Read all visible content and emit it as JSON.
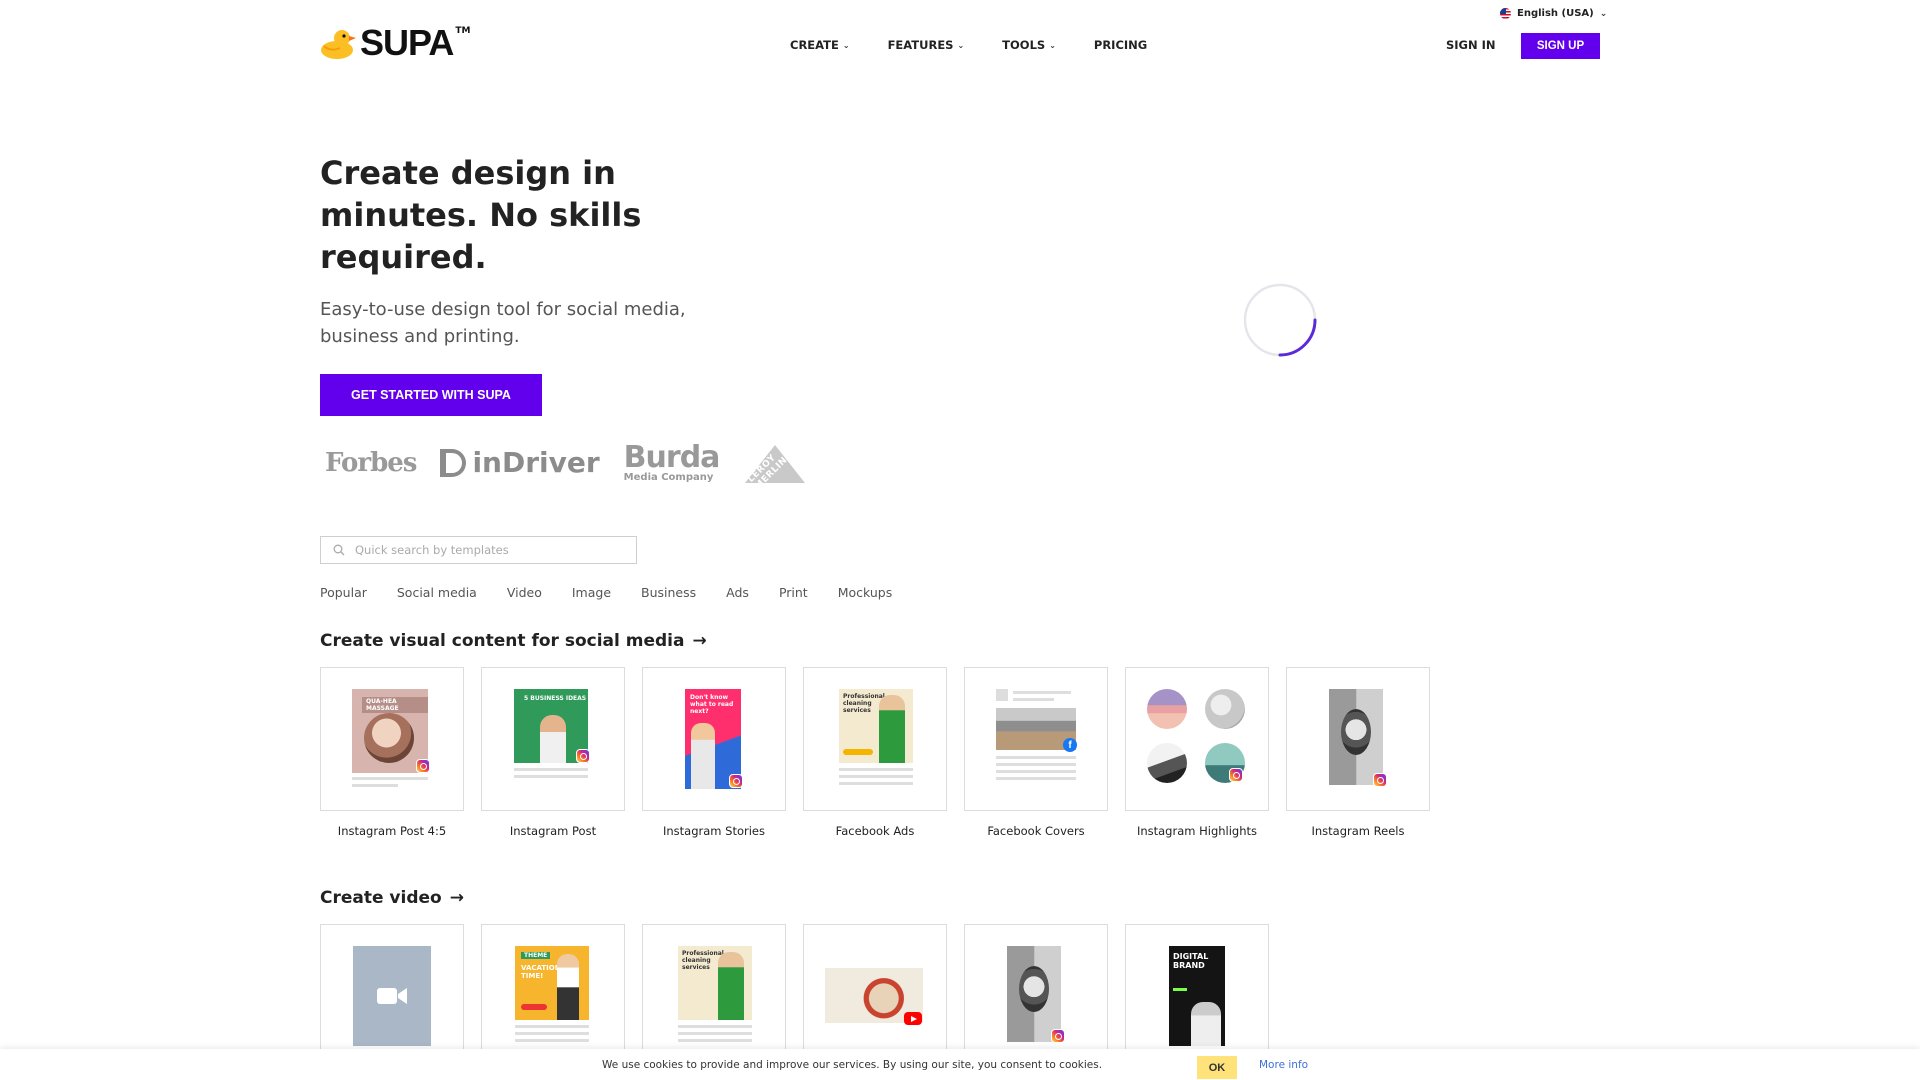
{
  "header": {
    "language": "English (USA)",
    "logo_text": "SUPA",
    "logo_tm": "TM",
    "nav": [
      "CREATE",
      "FEATURES",
      "TOOLS",
      "PRICING"
    ],
    "sign_in": "SIGN IN",
    "sign_up": "SIGN UP"
  },
  "hero": {
    "title": "Create design in minutes. No skills required.",
    "subtitle": "Easy-to-use design tool for social media, business and printing.",
    "cta": "GET STARTED WITH SUPA",
    "brands": {
      "forbes": "Forbes",
      "indriver": "inDriver",
      "burda": "Burda",
      "burda_sub": "Media Company",
      "leroy": "LEROY MERLIN"
    }
  },
  "search": {
    "placeholder": "Quick search by templates"
  },
  "tabs": [
    "Popular",
    "Social media",
    "Video",
    "Image",
    "Business",
    "Ads",
    "Print",
    "Mockups"
  ],
  "social_section": {
    "title": "Create visual content for social media",
    "arrow": "→",
    "cards": [
      "Instagram Post 4:5",
      "Instagram Post",
      "Instagram Stories",
      "Facebook Ads",
      "Facebook Covers",
      "Instagram Highlights",
      "Instagram Reels"
    ]
  },
  "video_section": {
    "title": "Create video",
    "arrow": "→",
    "thumbs": {
      "vacation_tag": "THEME",
      "vacation_text": "VACATION TIME!",
      "digital_brand": "DIGITAL BRAND"
    }
  },
  "thumb_text": {
    "massage": "QUA-HEA MASSAGE",
    "business_ideas": "5 BUSINESS IDEAS",
    "stories": "Don't know what to read next?",
    "cleaning": "Professional cleaning services",
    "fb_letter": "f"
  },
  "cookie": {
    "text": "We use cookies to provide and improve our services. By using our site, you consent to cookies.",
    "ok": "OK",
    "more": "More info"
  },
  "colors": {
    "accent": "#6200ee",
    "cookie_ok": "#ffe27a",
    "link": "#3d6fd8"
  }
}
